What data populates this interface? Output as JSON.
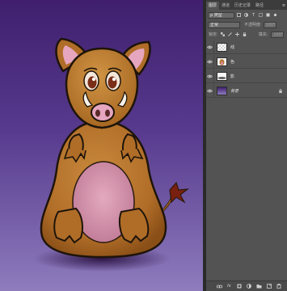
{
  "panel": {
    "tabs": [
      {
        "label": "图层",
        "active": true
      },
      {
        "label": "通道",
        "active": false
      },
      {
        "label": "历史记录",
        "active": false
      },
      {
        "label": "路径",
        "active": false
      }
    ],
    "filter": {
      "kind_label": "ρ 类型"
    },
    "blend_mode": {
      "value": "正常",
      "opacity_label": "不透明度:",
      "opacity_value": "100%"
    },
    "lock_row": {
      "label": "锁定:",
      "fill_label": "填充:",
      "fill_value": "100%"
    },
    "layers": [
      {
        "name": "线",
        "thumb": "checker",
        "visible": true,
        "selected": false,
        "locked": false
      },
      {
        "name": "色",
        "thumb": "color",
        "visible": true,
        "selected": false,
        "locked": false
      },
      {
        "name": "影",
        "thumb": "shadow",
        "visible": true,
        "selected": false,
        "locked": false
      },
      {
        "name": "背景",
        "thumb": "purple",
        "visible": true,
        "selected": false,
        "locked": true
      }
    ]
  },
  "colors": {
    "canvas_top": "#3f1f6e",
    "canvas_bottom": "#8e7cbd",
    "body": "#b8732b",
    "belly": "#d48fa8",
    "panel_bg": "#535353"
  }
}
